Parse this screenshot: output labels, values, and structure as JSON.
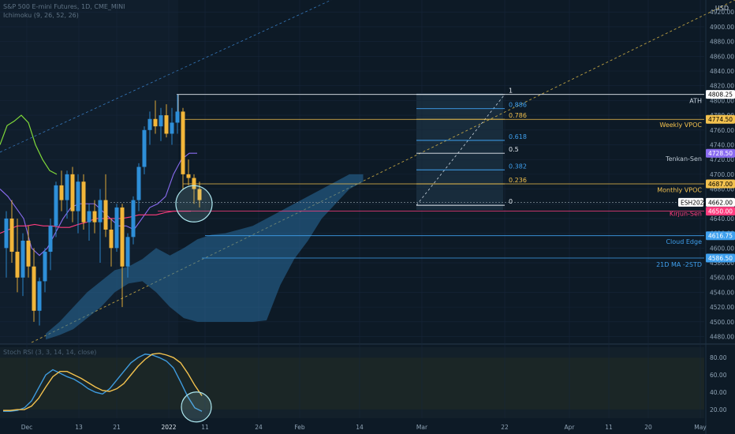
{
  "header": {
    "symbol_line": "S&P 500 E-mini Futures, 1D, CME_MINI",
    "indicator_line": "Ichimoku (9, 26, 52, 26)"
  },
  "currency": "USD",
  "colors": {
    "background": "#0d1a26",
    "candle_up": "#2e8fd8",
    "candle_down": "#f2b63a",
    "fib_white": "#e6ecf2",
    "fib_yellow": "#f2c14e",
    "fib_blue": "#3fa0ee",
    "tenkan": "#8a6cf0",
    "kijun": "#ff3d7f",
    "chikou": "#7fd83a",
    "cloud": "#2a6d9f",
    "stoch_k": "#3f9bde",
    "stoch_d": "#f2c14e",
    "circle": "#aee8f0"
  },
  "chart_data": [
    {
      "type": "candlestick",
      "name": "main",
      "y_axis": {
        "range": [
          4472,
          4932
        ],
        "ticks": [
          4480,
          4500,
          4520,
          4540,
          4560,
          4580,
          4600,
          4620,
          4640,
          4660,
          4680,
          4700,
          4720,
          4740,
          4760,
          4780,
          4800,
          4820,
          4840,
          4860,
          4880,
          4900,
          4920
        ]
      },
      "x_axis": {
        "labels": [
          "Dec",
          "13",
          "21",
          "2022",
          "11",
          "24",
          "Feb",
          "14",
          "Mar",
          "22",
          "Apr",
          "11",
          "20",
          "May"
        ]
      },
      "candles_ohlc": [
        [
          4600,
          4650,
          4560,
          4640
        ],
        [
          4640,
          4665,
          4580,
          4595
        ],
        [
          4595,
          4640,
          4540,
          4560
        ],
        [
          4560,
          4620,
          4535,
          4610
        ],
        [
          4610,
          4630,
          4560,
          4575
        ],
        [
          4575,
          4600,
          4500,
          4515
        ],
        [
          4515,
          4560,
          4495,
          4555
        ],
        [
          4555,
          4600,
          4540,
          4595
        ],
        [
          4595,
          4640,
          4570,
          4630
        ],
        [
          4630,
          4690,
          4615,
          4685
        ],
        [
          4685,
          4705,
          4650,
          4665
        ],
        [
          4665,
          4705,
          4640,
          4700
        ],
        [
          4700,
          4710,
          4635,
          4650
        ],
        [
          4650,
          4700,
          4620,
          4690
        ],
        [
          4690,
          4700,
          4625,
          4635
        ],
        [
          4635,
          4660,
          4610,
          4650
        ],
        [
          4650,
          4665,
          4620,
          4635
        ],
        [
          4635,
          4680,
          4580,
          4665
        ],
        [
          4665,
          4700,
          4615,
          4625
        ],
        [
          4625,
          4640,
          4575,
          4600
        ],
        [
          4600,
          4660,
          4595,
          4655
        ],
        [
          4655,
          4660,
          4520,
          4575
        ],
        [
          4575,
          4620,
          4560,
          4615
        ],
        [
          4615,
          4670,
          4605,
          4665
        ],
        [
          4665,
          4715,
          4650,
          4710
        ],
        [
          4710,
          4765,
          4700,
          4760
        ],
        [
          4760,
          4785,
          4740,
          4775
        ],
        [
          4775,
          4800,
          4755,
          4765
        ],
        [
          4765,
          4790,
          4745,
          4780
        ],
        [
          4780,
          4795,
          4750,
          4755
        ],
        [
          4755,
          4790,
          4740,
          4770
        ],
        [
          4770,
          4808,
          4755,
          4785
        ],
        [
          4785,
          4790,
          4680,
          4700
        ],
        [
          4700,
          4720,
          4685,
          4695
        ],
        [
          4695,
          4700,
          4660,
          4680
        ],
        [
          4680,
          4690,
          4655,
          4665
        ]
      ],
      "fibonacci": {
        "levels": [
          "1",
          "0.886",
          "0.786",
          "0.618",
          "0.5",
          "0.382",
          "0.236",
          "0"
        ],
        "prices": [
          4808.25,
          4789,
          4774.5,
          4746,
          4728.5,
          4706,
          4687,
          4658
        ]
      },
      "price_tags": [
        {
          "value": "4808.25",
          "price": 4808.25
        },
        {
          "value": "4774.50",
          "price": 4774.5
        },
        {
          "value": "4728.50",
          "price": 4728.5
        },
        {
          "value": "4687.00",
          "price": 4687
        },
        {
          "value": "ESH2022",
          "price": 4662
        },
        {
          "value": "4662.00",
          "price": 4662
        },
        {
          "value": "4650.00",
          "price": 4650
        },
        {
          "value": "4616.75",
          "price": 4616.75
        },
        {
          "value": "4586.50",
          "price": 4586.5
        }
      ],
      "annotations": [
        {
          "text": "ATH",
          "price": 4800
        },
        {
          "text": "Weekly VPOC",
          "price": 4767
        },
        {
          "text": "Tenkan-Sen",
          "price": 4721
        },
        {
          "text": "Monthly VPOC",
          "price": 4679
        },
        {
          "text": "Kirjun-Sen",
          "price": 4647
        },
        {
          "text": "Cloud Edge",
          "price": 4609
        },
        {
          "text": "21D MA -2STD",
          "price": 4578
        }
      ],
      "horizontal_levels": {
        "ath": 4808.25,
        "weekly_vpoc": 4774.5,
        "tenkan": 4728.5,
        "monthly_vpoc": 4687,
        "last": 4662,
        "kijun": 4650,
        "cloud_edge": 4616.75,
        "ma_minus_2std": 4586.5
      }
    },
    {
      "type": "line",
      "name": "stochastic_rsi",
      "title": "Stoch RSI (3, 3, 14, 14, close)",
      "y_axis": {
        "range": [
          10,
          92
        ],
        "ticks": [
          20,
          40,
          60,
          80
        ]
      },
      "series": [
        {
          "values": [
            18,
            18,
            19,
            22,
            30,
            45,
            60,
            66,
            62,
            58,
            55,
            50,
            44,
            40,
            38,
            44,
            54,
            64,
            74,
            80,
            84,
            83,
            80,
            76,
            68,
            52,
            35,
            22,
            18
          ]
        },
        {
          "values": [
            19,
            19,
            20,
            20,
            24,
            33,
            46,
            58,
            64,
            64,
            60,
            56,
            51,
            46,
            42,
            41,
            44,
            50,
            60,
            70,
            78,
            84,
            85,
            83,
            80,
            74,
            62,
            48,
            36
          ]
        }
      ]
    }
  ]
}
